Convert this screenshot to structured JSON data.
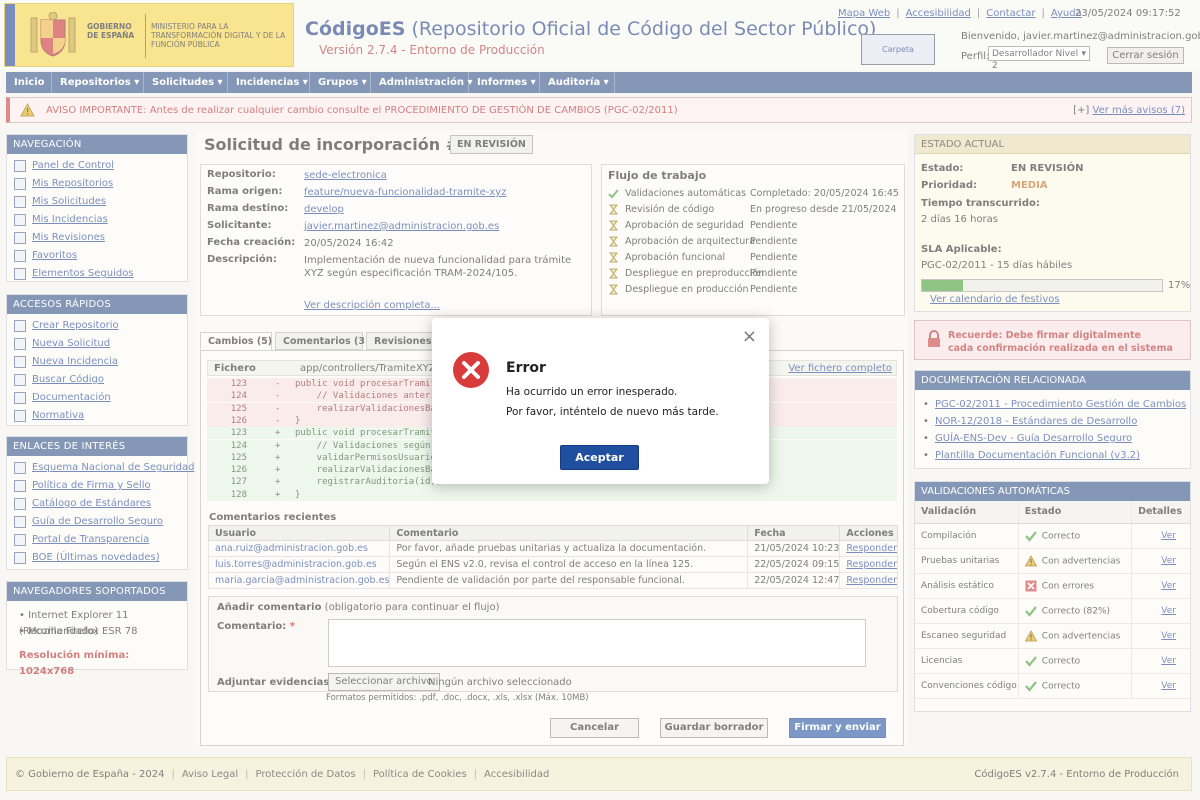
{
  "header": {
    "logo_line1": "GOBIERNO DE ESPAÑA",
    "logo_line2": "MINISTERIO PARA LA TRANSFORMACIÓN DIGITAL Y DE LA FUNCIÓN PÚBLICA",
    "app_name": "CódigoES",
    "app_subtitle": "(Repositorio Oficial de Código del Sector Público)",
    "app_version": "Versión 2.7.4 - Entorno de Producción",
    "links": [
      "Mapa Web",
      "Accesibilidad",
      "Contactar",
      "Ayuda"
    ],
    "datetime": "23/05/2024 09:17:52",
    "carpeta": "Carpeta Ciudadana",
    "welcome": "Bienvenido, javier.martinez@administracion.gob.es",
    "perfil_label": "Perfil:",
    "perfil_value": "Desarrollador Nivel 2",
    "logout": "Cerrar sesión"
  },
  "nav": [
    "Inicio",
    "Repositorios ▾",
    "Solicitudes ▾",
    "Incidencias ▾",
    "Grupos ▾",
    "Administración ▾",
    "Informes ▾",
    "Auditoría ▾"
  ],
  "alert": {
    "text": "AVISO IMPORTANTE: Antes de realizar cualquier cambio consulte el PROCEDIMIENTO DE GESTIÓN DE CAMBIOS (PGC-02/2011)",
    "more_prefix": "[+]",
    "more": "Ver más avisos (7)"
  },
  "sidebar": {
    "nav_title": "NAVEGACIÓN",
    "nav_items": [
      "Panel de Control",
      "Mis Repositorios",
      "Mis Solicitudes",
      "Mis Incidencias",
      "Mis Revisiones",
      "Favoritos",
      "Elementos Seguidos"
    ],
    "quick_title": "ACCESOS RÁPIDOS",
    "quick_items": [
      "Crear Repositorio",
      "Nueva Solicitud",
      "Nueva Incidencia",
      "Buscar Código",
      "Documentación",
      "Normativa"
    ],
    "links_title": "ENLACES DE INTERÉS",
    "links_items": [
      "Esquema Nacional de Seguridad",
      "Política de Firma y Sello",
      "Catálogo de Estándares",
      "Guía de Desarrollo Seguro",
      "Portal de Transparencia",
      "BOE (Últimas novedades)"
    ],
    "browsers_title": "NAVEGADORES SOPORTADOS",
    "browsers": [
      "Internet Explorer 11 (Recomendado)",
      "Mozilla Firefox ESR 78"
    ],
    "min_res": "Resolución mínima: 1024x768"
  },
  "request": {
    "title": "Solicitud de incorporación #87421",
    "status": "EN REVISIÓN",
    "fields": {
      "repo_k": "Repositorio:",
      "repo_v": "sede-electronica",
      "origin_k": "Rama origen:",
      "origin_v": "feature/nueva-funcionalidad-tramite-xyz",
      "dest_k": "Rama destino:",
      "dest_v": "develop",
      "sol_k": "Solicitante:",
      "sol_v": "javier.martinez@administracion.gob.es",
      "date_k": "Fecha creación:",
      "date_v": "20/05/2024 16:42",
      "desc_k": "Descripción:",
      "desc_v": "Implementación de nueva funcionalidad para trámite XYZ según especificación TRAM-2024/105.",
      "desc_link": "Ver descripción completa..."
    }
  },
  "workflow": {
    "title": "Flujo de trabajo",
    "steps": [
      {
        "name": "Validaciones automáticas",
        "status": "Completado: 20/05/2024 16:45",
        "state": "done"
      },
      {
        "name": "Revisión de código",
        "status": "En progreso desde 21/05/2024",
        "state": "wait"
      },
      {
        "name": "Aprobación de seguridad",
        "status": "Pendiente",
        "state": "wait"
      },
      {
        "name": "Aprobación de arquitectura",
        "status": "Pendiente",
        "state": "wait"
      },
      {
        "name": "Aprobación funcional",
        "status": "Pendiente",
        "state": "wait"
      },
      {
        "name": "Despliegue en preproducción",
        "status": "Pendiente",
        "state": "wait"
      },
      {
        "name": "Despliegue en producción",
        "status": "Pendiente",
        "state": "wait"
      }
    ]
  },
  "tabs": [
    "Cambios (5)",
    "Comentarios (3)",
    "Revisiones (2"
  ],
  "diff": {
    "file_label": "Fichero",
    "file_path": "app/controllers/TramiteXYZCon",
    "file_link": "Ver fichero completo",
    "lines": [
      {
        "no": "123",
        "mark": "-",
        "text": "public void procesarTramite(Str",
        "type": "del"
      },
      {
        "no": "124",
        "mark": "-",
        "text": "    // Validaciones anteriores",
        "type": "del"
      },
      {
        "no": "125",
        "mark": "-",
        "text": "    realizarValidacionesBasicas(i",
        "type": "del"
      },
      {
        "no": "126",
        "mark": "-",
        "text": "}",
        "type": "del"
      },
      {
        "no": "123",
        "mark": "+",
        "text": "public void procesarTramite(Str",
        "type": "add"
      },
      {
        "no": "124",
        "mark": "+",
        "text": "    // Validaciones según nueva",
        "type": "add"
      },
      {
        "no": "125",
        "mark": "+",
        "text": "    validarPermisosUsuario(id);",
        "type": "add"
      },
      {
        "no": "126",
        "mark": "+",
        "text": "    realizarValidacionesBasicas(",
        "type": "add"
      },
      {
        "no": "127",
        "mark": "+",
        "text": "    registrarAuditoria(id);",
        "type": "add"
      },
      {
        "no": "128",
        "mark": "+",
        "text": "}",
        "type": "add"
      }
    ]
  },
  "comments": {
    "title": "Comentarios recientes",
    "headers": [
      "Usuario",
      "Comentario",
      "Fecha",
      "Acciones"
    ],
    "rows": [
      {
        "user": "ana.ruiz@administracion.gob.es",
        "text": "Por favor, añade pruebas unitarias y actualiza la documentación.",
        "date": "21/05/2024 10:23",
        "action": "Responder"
      },
      {
        "user": "luis.torres@administracion.gob.es",
        "text": "Según el ENS v2.0, revisa el control de acceso en la línea 125.",
        "date": "22/05/2024 09:15",
        "action": "Responder"
      },
      {
        "user": "maria.garcia@administracion.gob.es",
        "text": "Pendiente de validación por parte del responsable funcional.",
        "date": "22/05/2024 12:47",
        "action": "Responder"
      }
    ]
  },
  "add_comment": {
    "title": "Añadir comentario",
    "title_note": "(obligatorio para continuar el flujo)",
    "label": "Comentario:",
    "required": "*",
    "evidence_label": "Adjuntar evidencias:",
    "file_button": "Seleccionar archivo",
    "no_file": "Ningún archivo seleccionado",
    "formats": "Formatos permitidos: .pdf, .doc, .docx, .xls, .xlsx (Máx. 10MB)"
  },
  "buttons": {
    "cancel": "Cancelar",
    "draft": "Guardar borrador",
    "sign": "Firmar y enviar"
  },
  "status_panel": {
    "title": "ESTADO ACTUAL",
    "estado_k": "Estado:",
    "estado_v": "EN REVISIÓN",
    "prioridad_k": "Prioridad:",
    "prioridad_v": "MEDIA",
    "tiempo_k": "Tiempo transcurrido:",
    "tiempo_v": "2 días 16 horas",
    "sla_k": "SLA Aplicable:",
    "sla_v": "PGC-02/2011 - 15 días hábiles",
    "sla_progress": 0.17,
    "sla_pct": "17%",
    "sla_link": "Ver calendario de festivos"
  },
  "sign_notice": {
    "line1": "Recuerde: Debe firmar digitalmente",
    "line2": "cada confirmación realizada en el sistema"
  },
  "docs": {
    "title": "DOCUMENTACIÓN RELACIONADA",
    "items": [
      "PGC-02/2011 - Procedimiento Gestión de Cambios",
      "NOR-12/2018 - Estándares de Desarrollo",
      "GUÍA-ENS-Dev - Guía Desarrollo Seguro",
      "Plantilla Documentación Funcional (v3.2)"
    ]
  },
  "validations": {
    "title": "VALIDACIONES AUTOMÁTICAS",
    "headers": [
      "Validación",
      "Estado",
      "Detalles"
    ],
    "rows": [
      {
        "name": "Compilación",
        "status": "Correcto",
        "kind": "ok",
        "link": "Ver"
      },
      {
        "name": "Pruebas unitarias",
        "status": "Con advertencias",
        "kind": "warn",
        "link": "Ver"
      },
      {
        "name": "Análisis estático",
        "status": "Con errores",
        "kind": "err",
        "link": "Ver"
      },
      {
        "name": "Cobertura código",
        "status": "Correcto (82%)",
        "kind": "ok",
        "link": "Ver"
      },
      {
        "name": "Escaneo seguridad",
        "status": "Con advertencias",
        "kind": "warn",
        "link": "Ver"
      },
      {
        "name": "Licencias",
        "status": "Correcto",
        "kind": "ok",
        "link": "Ver"
      },
      {
        "name": "Convenciones código",
        "status": "Correcto",
        "kind": "ok",
        "link": "Ver"
      }
    ]
  },
  "footer": {
    "copyright": "© Gobierno de España - 2024",
    "links": [
      "Aviso Legal",
      "Protección de Datos",
      "Política de Cookies",
      "Accesibilidad"
    ],
    "version": "CódigoES v2.7.4 - Entorno de Producción"
  },
  "modal": {
    "title": "Error",
    "line1": "Ha ocurrido un error inesperado.",
    "line2": "Por favor, inténtelo de nuevo más tarde.",
    "button": "Aceptar",
    "close": "×"
  },
  "colors": {
    "accent": "#2e4d83",
    "error": "#d93a3a",
    "success": "#3f9a2b",
    "warning": "#e0a800"
  }
}
